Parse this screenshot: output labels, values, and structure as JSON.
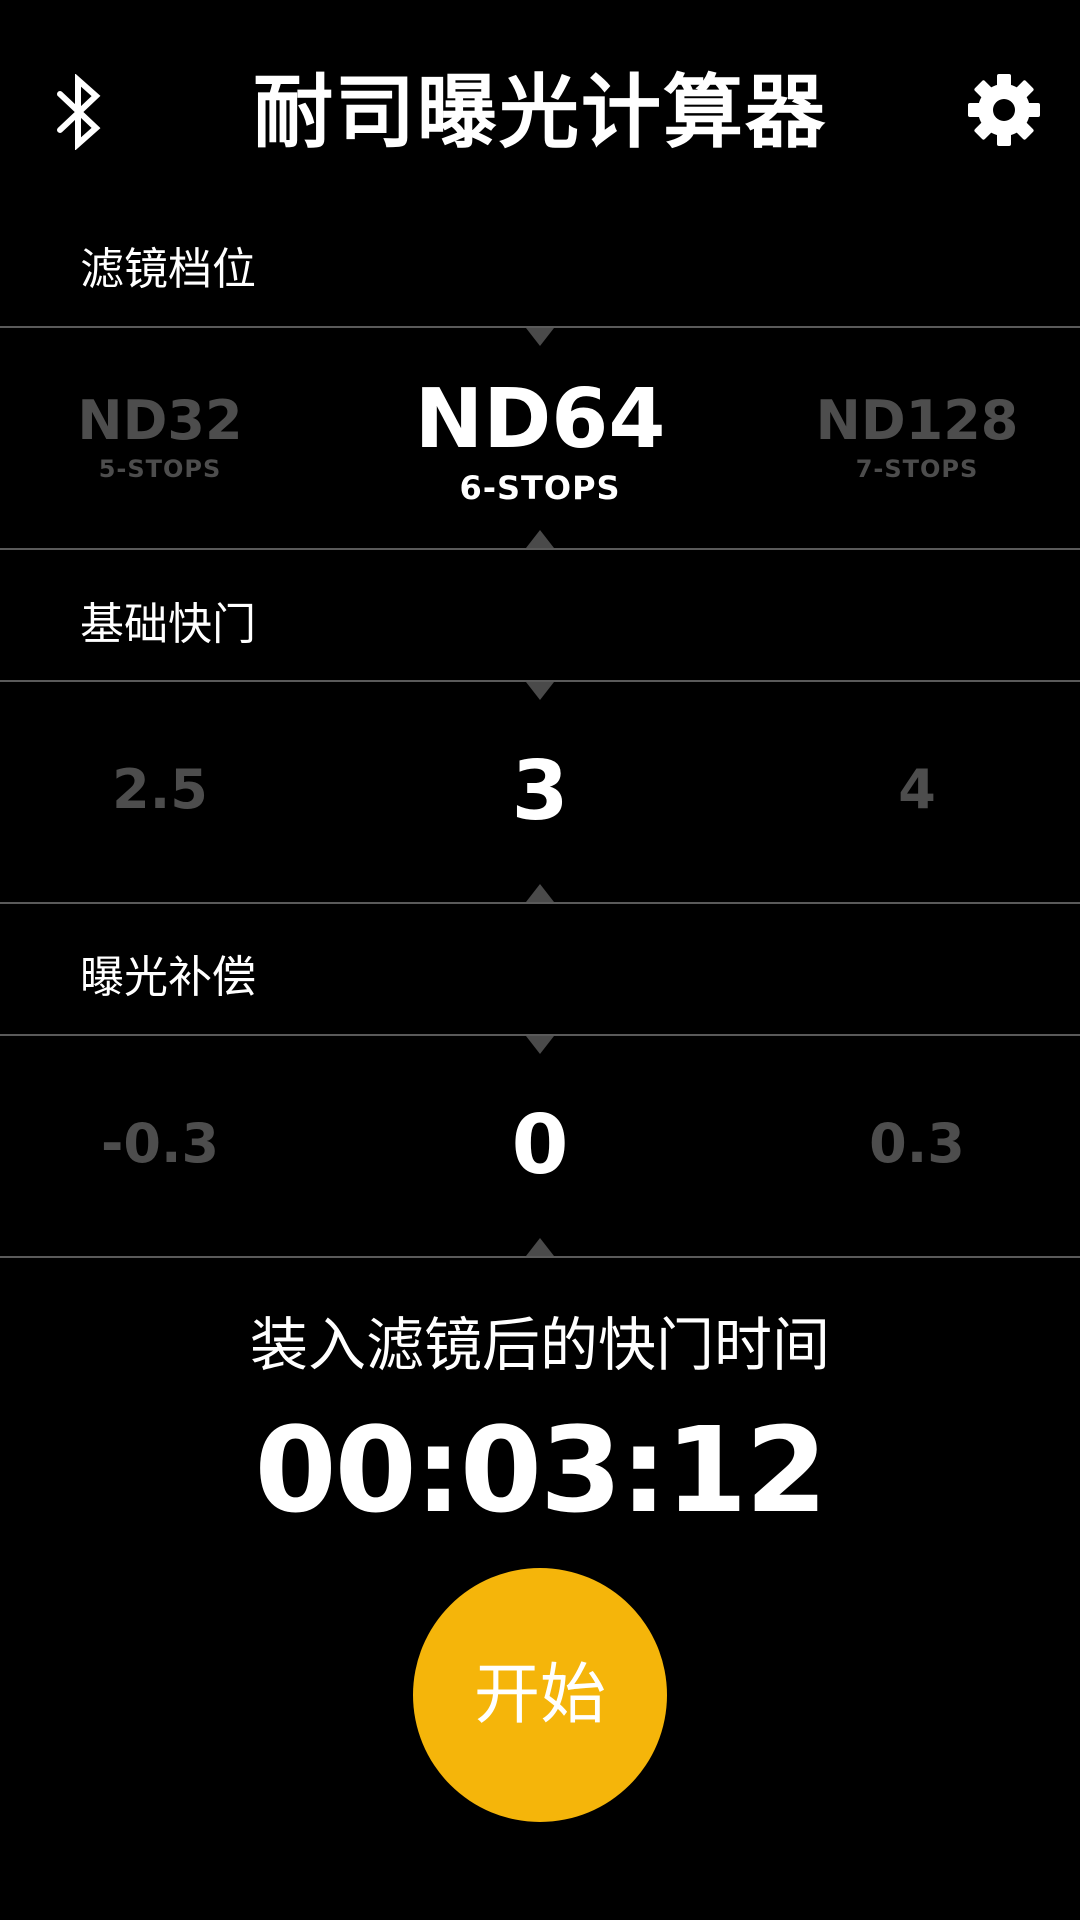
{
  "header": {
    "title": "耐司曝光计算器",
    "left_icon": "bluetooth-icon",
    "right_icon": "gear-icon"
  },
  "filter": {
    "label": "滤镜档位",
    "options": [
      {
        "name": "ND32",
        "stops": "5-STOPS"
      },
      {
        "name": "ND64",
        "stops": "6-STOPS"
      },
      {
        "name": "ND128",
        "stops": "7-STOPS"
      }
    ],
    "selected_index": 1
  },
  "shutter": {
    "label": "基础快门",
    "options": [
      "2.5",
      "3",
      "4"
    ],
    "selected_index": 1
  },
  "compensation": {
    "label": "曝光补偿",
    "options": [
      "-0.3",
      "0",
      "0.3"
    ],
    "selected_index": 1
  },
  "result": {
    "label": "装入滤镜后的快门时间",
    "time": "00:03:12"
  },
  "start_button": {
    "label": "开始"
  },
  "colors": {
    "background": "#000000",
    "accent": "#f5b50a",
    "dim_text": "#4d4d4d",
    "divider": "#5a5a5a"
  }
}
